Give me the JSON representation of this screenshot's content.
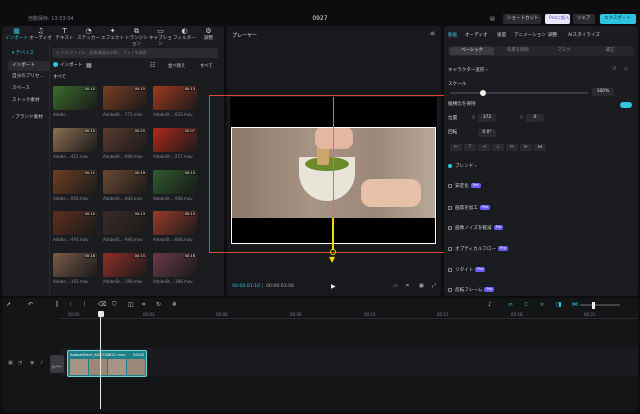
{
  "titlebar": {
    "autosave": "自動保存: 13:53:04",
    "project_title": "0927",
    "shortcut_label": "ショートカット",
    "pro_label": "Proに加入",
    "share_label": "シェア",
    "export_label": "エクスポート"
  },
  "toolbar": {
    "tools": [
      {
        "label": "インポート",
        "icon": "▦"
      },
      {
        "label": "オーディオ",
        "icon": "♫"
      },
      {
        "label": "テキスト",
        "icon": "T"
      },
      {
        "label": "ステッカー",
        "icon": "◔"
      },
      {
        "label": "エフェクト",
        "icon": "✦"
      },
      {
        "label": "トランジション",
        "icon": "⧉"
      },
      {
        "label": "キャプション",
        "icon": "▭"
      },
      {
        "label": "フィルター",
        "icon": "◐"
      },
      {
        "label": "調整",
        "icon": "⚙"
      }
    ]
  },
  "sidebar": {
    "items": [
      {
        "label": "▾ デバイス"
      },
      {
        "label": "インポート"
      },
      {
        "label": "自分のプリセ..."
      },
      {
        "label": "スペース"
      },
      {
        "label": "ストック素材"
      },
      {
        "label": "› ブランド素材"
      }
    ]
  },
  "media": {
    "search_placeholder": "ビデオ/ファイル、画像/動画のURL、フォトを検索",
    "import_label": "インポート",
    "sort_label": "並べ替え",
    "all_label": "すべて",
    "section_label": "すべて",
    "thumbs": [
      {
        "name": "Adobe...",
        "dur": "00:10",
        "color": "#3c6b2e"
      },
      {
        "name": "AdobeSt...-771.mov",
        "dur": "00:15",
        "color": "#7a3f24"
      },
      {
        "name": "AdobeSt...-833.mov",
        "dur": "00:13",
        "color": "#a03a1c"
      },
      {
        "name": "Adobe...-421.mov",
        "dur": "00:15",
        "color": "#8c6f52"
      },
      {
        "name": "AdobeSt...-946.mov",
        "dur": "00:25",
        "color": "#5a3a30"
      },
      {
        "name": "AdobeSt...-217.mov",
        "dur": "00:07",
        "color": "#b12a1a"
      },
      {
        "name": "Adobe...-093.mov",
        "dur": "00:12",
        "color": "#6e4021"
      },
      {
        "name": "AdobeSt...-843.mov",
        "dur": "00:19",
        "color": "#6b4a32"
      },
      {
        "name": "AdobeSt...-948.mov",
        "dur": "00:13",
        "color": "#2f5a2e"
      },
      {
        "name": "Adobe...-493.mov",
        "dur": "00:10",
        "color": "#5c2f1d"
      },
      {
        "name": "AdobeSt...-946.mov",
        "dur": "00:13",
        "color": "#3b2c28"
      },
      {
        "name": "AdobeSt...-848.mov",
        "dur": "00:13",
        "color": "#9a3b2c"
      },
      {
        "name": "Adobe...-193.mov",
        "dur": "00:18",
        "color": "#7a5a48"
      },
      {
        "name": "AdobeSt...-398.mov",
        "dur": "00:15",
        "color": "#8f2f28"
      },
      {
        "name": "AdobeSt...-388.mov",
        "dur": "00:16",
        "color": "#6a3b4a"
      }
    ]
  },
  "player": {
    "label": "プレーヤー",
    "current_time": "00:00:01:10",
    "total_time": "00:00:03:06"
  },
  "props": {
    "tabs": [
      {
        "label": "動画"
      },
      {
        "label": "オーディオ"
      },
      {
        "label": "速度"
      },
      {
        "label": "アニメーション"
      },
      {
        "label": "調整"
      },
      {
        "label": "AIスタイライズ"
      }
    ],
    "subtabs": [
      {
        "label": "ベーシック"
      },
      {
        "label": "背景を削除"
      },
      {
        "label": "マスク"
      },
      {
        "label": "補正"
      }
    ],
    "keyframe_label": "キャラクター変形 ›",
    "scale_label": "スケール",
    "scale_value": "100%",
    "ratio_label": "縦横比を保持",
    "position_label": "位置",
    "pos_x": "372",
    "pos_y": "0",
    "rotation_label": "回転",
    "rotation_value": "0.0°",
    "blend_label": "ブレンド ›",
    "stabilize_label": "安定化",
    "enhance_label": "画質を加工",
    "denoise_label": "画像ノイズを軽減",
    "optical_label": "オプティカルフロー",
    "retime_label": "リタイト",
    "freeze_label": "反転フレーム"
  },
  "timeline": {
    "ticks": [
      {
        "label": "00:00"
      },
      {
        "label": "00:03"
      },
      {
        "label": "00:06"
      },
      {
        "label": "00:09"
      },
      {
        "label": "00:12"
      },
      {
        "label": "00:15"
      },
      {
        "label": "00:18"
      },
      {
        "label": "00:21"
      }
    ],
    "clip_name": "AdobeStock_626738621.mov",
    "clip_dur": "00:00",
    "cover_label": "カバー"
  },
  "colors": {
    "accent": "#2ec5e0",
    "selection": "#e0453a",
    "guide": "#f5d800"
  }
}
